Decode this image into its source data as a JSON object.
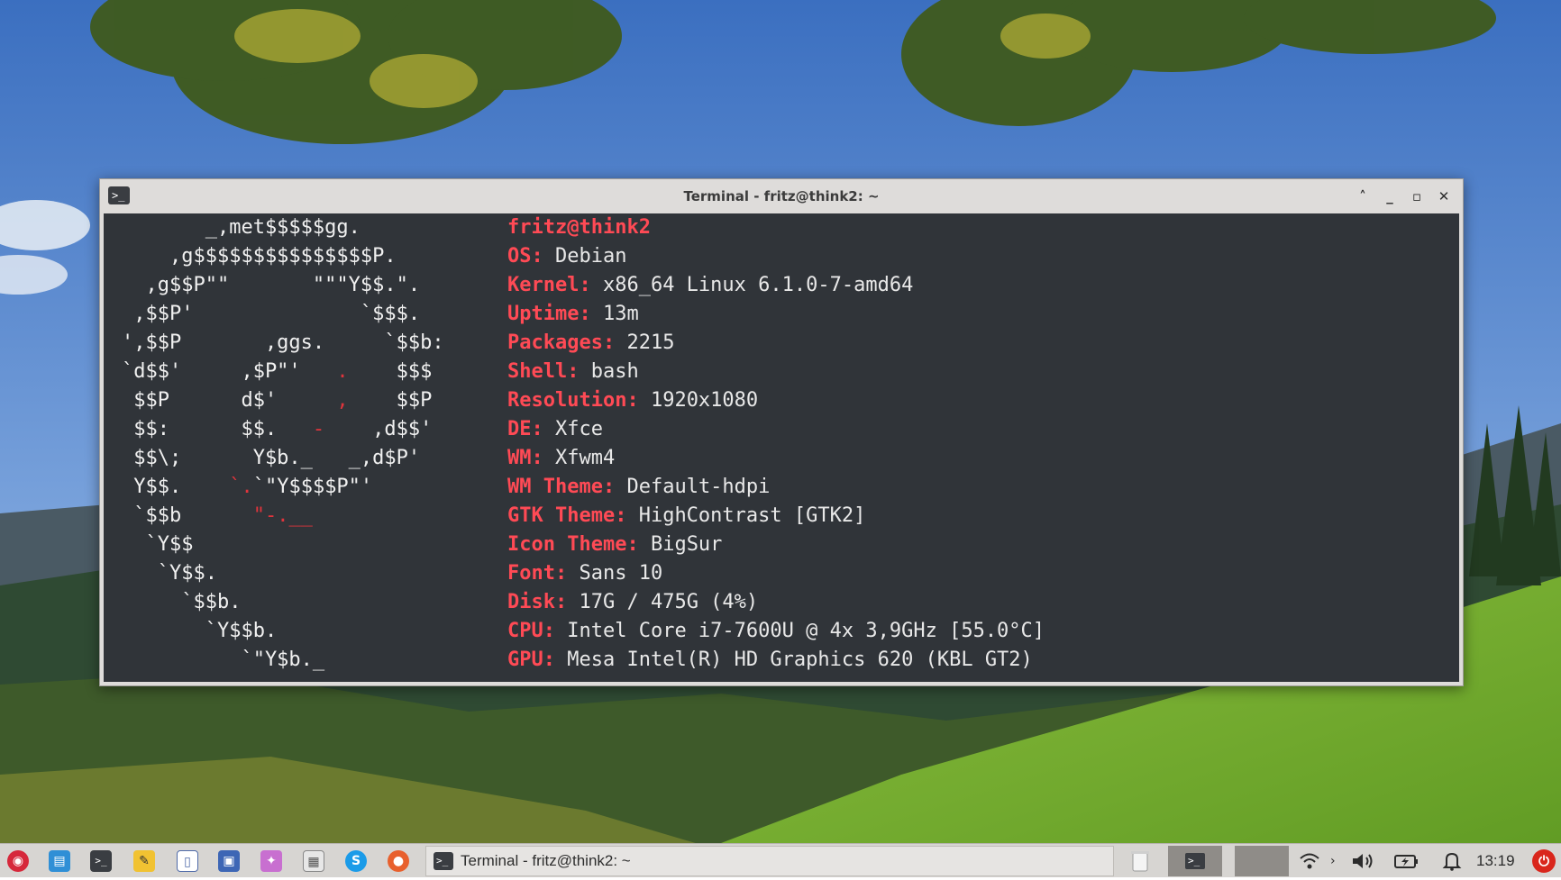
{
  "window": {
    "title": "Terminal - fritz@think2: ~",
    "app_icon": "terminal-icon",
    "controls": [
      "maximize-up-icon",
      "minimize-icon",
      "maximize-icon",
      "close-icon"
    ]
  },
  "terminal": {
    "host": "fritz@think2",
    "ascii_logo": [
      {
        "t": "       _,met$$$$$gg.",
        "r": ""
      },
      {
        "t": "    ,g$$$$$$$$$$$$$$$P.",
        "r": ""
      },
      {
        "t": "  ,g$$P\"\"       \"\"\"Y$$.\".",
        "r": ""
      },
      {
        "t": " ,$$P'              `$$$.",
        "r": ""
      },
      {
        "t": "',$$P       ,ggs.     `$$b:",
        "r": ""
      },
      {
        "t": "`d$$'     ,$P\"'   ",
        "r": ".",
        "t2": "    $$$"
      },
      {
        "t": " $$P      d$'     ",
        "r": ",",
        "t2": "    $$P"
      },
      {
        "t": " $$:      $$.   ",
        "r": "-",
        "t2": "    ,d$$'"
      },
      {
        "t": " $$\\;      Y$b._   _,d$P'",
        "r": ""
      },
      {
        "t": " Y$$.    ",
        "r": "`.",
        "t2": "`\"Y$$$$P\"'"
      },
      {
        "t": " `$$b      ",
        "r": "\"-.__",
        "t2": ""
      },
      {
        "t": "  `Y$$",
        "r": ""
      },
      {
        "t": "   `Y$$.",
        "r": ""
      },
      {
        "t": "     `$$b.",
        "r": ""
      },
      {
        "t": "       `Y$$b.",
        "r": ""
      },
      {
        "t": "          `\"Y$b._",
        "r": ""
      }
    ],
    "info": [
      {
        "key": "OS:",
        "value": "Debian"
      },
      {
        "key": "Kernel:",
        "value": "x86_64 Linux 6.1.0-7-amd64"
      },
      {
        "key": "Uptime:",
        "value": "13m"
      },
      {
        "key": "Packages:",
        "value": "2215"
      },
      {
        "key": "Shell:",
        "value": "bash"
      },
      {
        "key": "Resolution:",
        "value": "1920x1080"
      },
      {
        "key": "DE:",
        "value": "Xfce"
      },
      {
        "key": "WM:",
        "value": "Xfwm4"
      },
      {
        "key": "WM Theme:",
        "value": "Default-hdpi"
      },
      {
        "key": "GTK Theme:",
        "value": "HighContrast [GTK2]"
      },
      {
        "key": "Icon Theme:",
        "value": "BigSur"
      },
      {
        "key": "Font:",
        "value": "Sans 10"
      },
      {
        "key": "Disk:",
        "value": "17G / 475G (4%)"
      },
      {
        "key": "CPU:",
        "value": "Intel Core i7-7600U @ 4x 3,9GHz [55.0°C]"
      },
      {
        "key": "GPU:",
        "value": "Mesa Intel(R) HD Graphics 620 (KBL GT2)"
      }
    ]
  },
  "taskbar": {
    "launchers": [
      {
        "name": "debian-menu-icon",
        "color": "#d6283b"
      },
      {
        "name": "file-manager-icon",
        "color": "#2f8fd6"
      },
      {
        "name": "terminal-launcher-icon",
        "color": "#3a3d42"
      },
      {
        "name": "text-editor-icon",
        "color": "#f1c232"
      },
      {
        "name": "document-viewer-icon",
        "color": "#4f6aa8"
      },
      {
        "name": "screenshot-icon",
        "color": "#3d66b5"
      },
      {
        "name": "graphics-app-icon",
        "color": "#c86fd0"
      },
      {
        "name": "calculator-icon",
        "color": "#6d6d6d"
      },
      {
        "name": "skype-icon",
        "color": "#1b9be8"
      },
      {
        "name": "firefox-icon",
        "color": "#e8602d"
      }
    ],
    "task_label": "Terminal - fritz@think2: ~",
    "clock": "13:19"
  }
}
